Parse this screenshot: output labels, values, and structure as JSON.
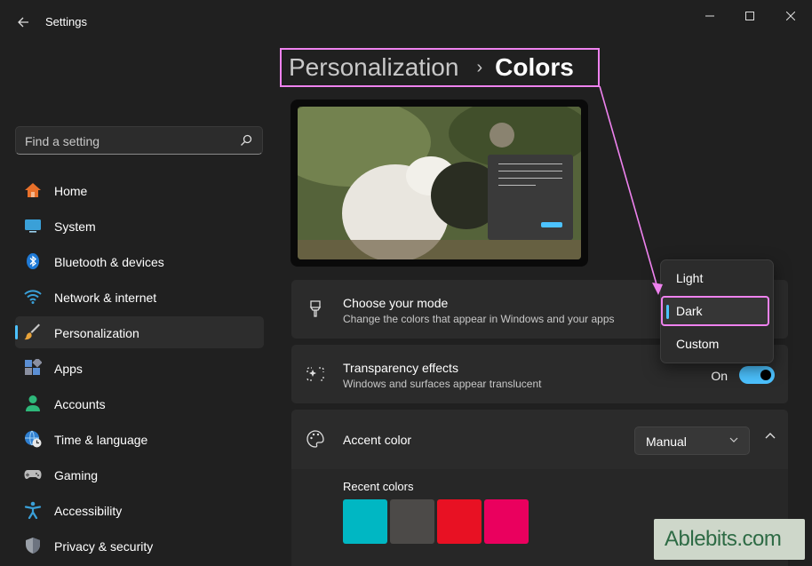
{
  "window": {
    "title": "Settings",
    "controls": {
      "minimize": "—",
      "maximize": "☐",
      "close": "✕"
    }
  },
  "breadcrumb": {
    "parent": "Personalization",
    "separator": "›",
    "current": "Colors"
  },
  "search": {
    "placeholder": "Find a setting"
  },
  "sidebar": {
    "items": [
      {
        "label": "Home",
        "icon": "home-icon",
        "active": false
      },
      {
        "label": "System",
        "icon": "monitor-icon",
        "active": false
      },
      {
        "label": "Bluetooth & devices",
        "icon": "bluetooth-icon",
        "active": false
      },
      {
        "label": "Network & internet",
        "icon": "wifi-icon",
        "active": false
      },
      {
        "label": "Personalization",
        "icon": "paintbrush-icon",
        "active": true
      },
      {
        "label": "Apps",
        "icon": "apps-icon",
        "active": false
      },
      {
        "label": "Accounts",
        "icon": "person-icon",
        "active": false
      },
      {
        "label": "Time & language",
        "icon": "globe-clock-icon",
        "active": false
      },
      {
        "label": "Gaming",
        "icon": "gamepad-icon",
        "active": false
      },
      {
        "label": "Accessibility",
        "icon": "accessibility-icon",
        "active": false
      },
      {
        "label": "Privacy & security",
        "icon": "shield-icon",
        "active": false
      }
    ]
  },
  "settings": {
    "mode": {
      "title": "Choose your mode",
      "description": "Change the colors that appear in Windows and your apps"
    },
    "transparency": {
      "title": "Transparency effects",
      "description": "Windows and surfaces appear translucent",
      "state_label": "On",
      "enabled": true
    },
    "accent": {
      "title": "Accent color",
      "selected": "Manual",
      "recent_label": "Recent colors",
      "recent_colors": [
        "#00b7c3",
        "#4c4a48",
        "#e81123",
        "#ea005e"
      ]
    }
  },
  "mode_dropdown": {
    "options": [
      "Light",
      "Dark",
      "Custom"
    ],
    "selected": "Dark"
  },
  "colors": {
    "accent": "#4cc2ff",
    "annotation": "#ee82ee",
    "background": "#202020",
    "card": "#2b2b2b"
  },
  "watermark": {
    "text": "Ablebits.com"
  }
}
